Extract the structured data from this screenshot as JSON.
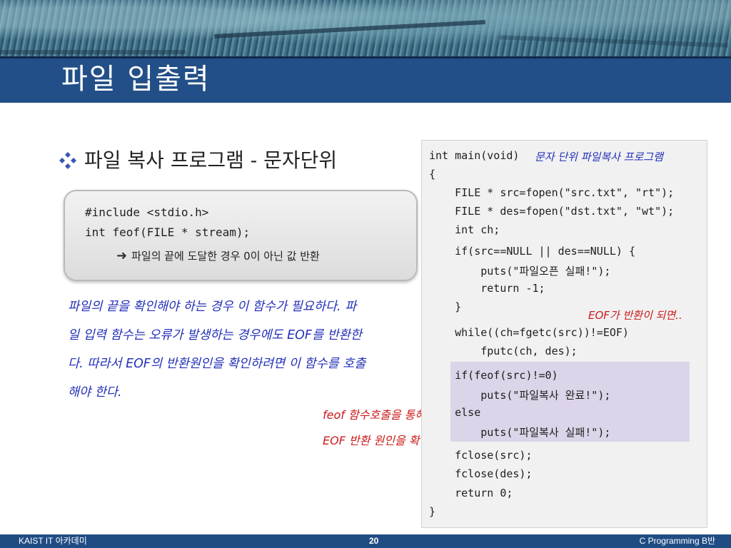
{
  "slide": {
    "title": "파일 입출력",
    "bullet_text": "파일 복사 프로그램 - 문자단위"
  },
  "include_box": {
    "line1": "#include <stdio.h>",
    "line2": "int feof(FILE * stream);",
    "note": "파일의 끝에 도달한 경우 0이 아닌 값 반환"
  },
  "handwritten": {
    "paragraph_lines": [
      "파일의 끝을 확인해야 하는 경우 이 함수가 필요하다. 파",
      "일 입력 함수는 오류가 발생하는 경우에도 EOF를 반환한",
      "다. 따라서 EOF의 반환원인을 확인하려면 이 함수를 호출",
      "해야 한다."
    ],
    "feof_note_line1": "feof 함수호출을 통해서",
    "feof_note_line2": "EOF 반환 원인을 확인!"
  },
  "code": {
    "comment": "문자 단위 파일복사 프로그램",
    "eof_note": "EOF가 반환이 되면..",
    "lines": [
      "int main(void)",
      "{",
      "    FILE * src=fopen(\"src.txt\", \"rt\");",
      "    FILE * des=fopen(\"dst.txt\", \"wt\");",
      "    int ch;",
      "    if(src==NULL || des==NULL) {",
      "        puts(\"파일오픈 실패!\");",
      "        return -1;",
      "    }",
      "    while((ch=fgetc(src))!=EOF)",
      "        fputc(ch, des);",
      "    if(feof(src)!=0)",
      "        puts(\"파일복사 완료!\");",
      "    else",
      "        puts(\"파일복사 실패!\");",
      "    fclose(src);",
      "    fclose(des);",
      "    return 0;",
      "}"
    ]
  },
  "footer": {
    "left": "KAIST IT 아카데미",
    "page_number": "20",
    "right": "C Programming B반"
  },
  "colors": {
    "title_bar": "#224f87",
    "footer_bar": "#1f4c83",
    "handwriting_blue": "#2330b8",
    "handwriting_red": "#cc1a1a",
    "code_highlight": "#dcd4e8",
    "bullet_icon": "#3a56b0"
  },
  "icons": {
    "bullet": "diamond-bullet-icon",
    "note_arrow": "right-arrow-icon"
  }
}
